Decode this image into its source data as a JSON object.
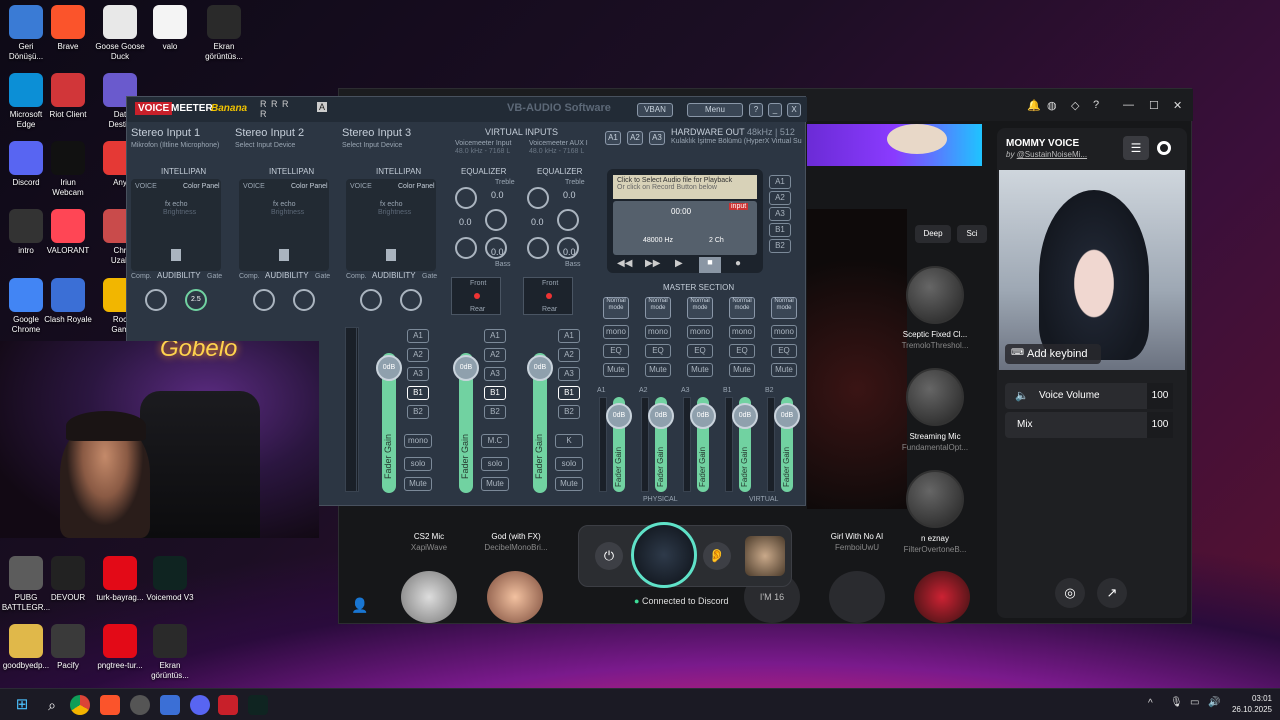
{
  "desktop_icons": [
    {
      "label": "Geri\nDönüşü...",
      "color": "#3a7bd5"
    },
    {
      "label": "Brave",
      "color": "#fb542b"
    },
    {
      "label": "Goose Goose\nDuck",
      "color": "#e8e8e8"
    },
    {
      "label": "valo",
      "color": "#f4f4f4"
    },
    {
      "label": "Ekran\ngörüntüs...",
      "color": "#2a2a2a"
    },
    {
      "label": "Microsoft\nEdge",
      "color": "#0c8fd6"
    },
    {
      "label": "Riot Client",
      "color": "#d13639"
    },
    {
      "label": "Dat\nDestin",
      "color": "#6a5acd"
    },
    {
      "label": "Discord",
      "color": "#5865f2"
    },
    {
      "label": "Iriun\nWebcam",
      "color": "#111111"
    },
    {
      "label": "Any",
      "color": "#e53935"
    },
    {
      "label": "intro",
      "color": "#333333"
    },
    {
      "label": "VALORANT",
      "color": "#ff4655"
    },
    {
      "label": "Chr\nUzak",
      "color": "#c94b4b"
    },
    {
      "label": "Google\nChrome",
      "color": "#4285f4"
    },
    {
      "label": "Clash Royale",
      "color": "#3b6fd6"
    },
    {
      "label": "Roc\nGam",
      "color": "#f2b600"
    },
    {
      "label": "PUBG\nBATTLEGR...",
      "color": "#5c5c5c"
    },
    {
      "label": "DEVOUR",
      "color": "#222222"
    },
    {
      "label": "turk-bayrag...",
      "color": "#e30a17"
    },
    {
      "label": "Voicemod V3",
      "color": "#0f2421"
    },
    {
      "label": "goodbyedp...",
      "color": "#e0b84a"
    },
    {
      "label": "Pacify",
      "color": "#3a3a3a"
    },
    {
      "label": "pngtree-tur...",
      "color": "#e30a17"
    },
    {
      "label": "Ekran\ngörüntüs...",
      "color": "#2a2a2a"
    }
  ],
  "voicemeeter": {
    "brand_voice": "VOICE",
    "brand_meeter": "MEETER",
    "brand_edition": "Banana",
    "rrrr": "R R R R",
    "a_badge": "A",
    "vban": "VBAN",
    "menu": "Menu",
    "help": "?",
    "minimize": "_",
    "close": "X",
    "watermark": "VB-AUDIO Software",
    "strips": [
      {
        "title": "Stereo Input 1",
        "device": "Mikrofon (Iltline  Microphone)"
      },
      {
        "title": "Stereo Input 2",
        "device": "Select Input Device"
      },
      {
        "title": "Stereo Input 3",
        "device": "Select Input Device"
      }
    ],
    "virtual_inputs": "VIRTUAL INPUTS",
    "virtual_strips": [
      {
        "name": "Voicemeeter Input",
        "rate": "48.0 kHz - 7168 L"
      },
      {
        "name": "Voicemeeter AUX I",
        "rate": "48.0 kHz - 7168 L"
      }
    ],
    "hw_buttons": [
      "A1",
      "A2",
      "A3"
    ],
    "hardware_out": "HARDWARE OUT",
    "hardware_out_spec": "48kHz | 512",
    "hardware_out_device": "Kulaklık İşitme Bölümü (HyperX Virtual Su",
    "intellipan": "INTELLIPAN",
    "voice": "VOICE",
    "color_panel": "Color Panel",
    "fx_echo": "fx echo",
    "brightness": "Brightness",
    "comp": "Comp.",
    "audibility": "AUDIBILITY",
    "gate": "Gate",
    "knob_value": "2.5",
    "equalizer": "EQUALIZER",
    "treble": "Treble",
    "bass": "Bass",
    "eq_zero": "0.0",
    "front": "Front",
    "rear": "Rear",
    "bus_buttons": [
      "A1",
      "A2",
      "A3",
      "B1",
      "B2"
    ],
    "mono": "mono",
    "solo": "solo",
    "mute": "Mute",
    "mc": "M.C",
    "k": "K",
    "fader_gain": "Fader Gain",
    "fader_value": "0dB",
    "playback_line1": "Click to Select Audio file for Playback",
    "playback_line2": "Or click on Record Button below",
    "time": "00:00",
    "input_label": "input",
    "sample_rate": "48000 Hz",
    "channels": "2 Ch",
    "tape_buttons": [
      "A1",
      "A2",
      "A3",
      "B1",
      "B2"
    ],
    "master_section": "MASTER SECTION",
    "normal_mode": "Normal\nmode",
    "eq": "EQ",
    "mono_btn": "mono",
    "mute_btn": "Mute",
    "bus_names": [
      "A1",
      "A2",
      "A3",
      "B1",
      "B2"
    ],
    "physical": "PHYSICAL",
    "virtual": "VIRTUAL"
  },
  "voicemod": {
    "header_tabs": [
      "Deep",
      "Sci"
    ],
    "voices": [
      {
        "name": "Sceptic Fixed Cl...",
        "author": "TremoloThreshol..."
      },
      {
        "name": "Streaming Mic",
        "author": "FundamentalOpt..."
      },
      {
        "name": "n eznay",
        "author": "FilterOvertoneB..."
      },
      {
        "name": "CS2 Mic",
        "author": "XapiWave"
      },
      {
        "name": "God (with FX)",
        "author": "DecibelMonoBri..."
      },
      {
        "name": "Girl With No AI",
        "author": "FemboiUwU"
      },
      {
        "name": "I'M 16",
        "author": ""
      }
    ],
    "panel": {
      "title": "MOMMY VOICE",
      "by": "by",
      "author": "@SustainNoiseMi...",
      "add_keybind": "Add keybind",
      "voice_volume_label": "Voice Volume",
      "voice_volume": "100",
      "mix_label": "Mix",
      "mix_value": "100"
    },
    "connected": "Connected to Discord",
    "window_controls": [
      "—",
      "☐",
      "✕"
    ]
  },
  "webcam": {
    "neon_text": "Gobelo"
  },
  "taskbar": {
    "time": "03:01",
    "date": "26.10.2025"
  }
}
